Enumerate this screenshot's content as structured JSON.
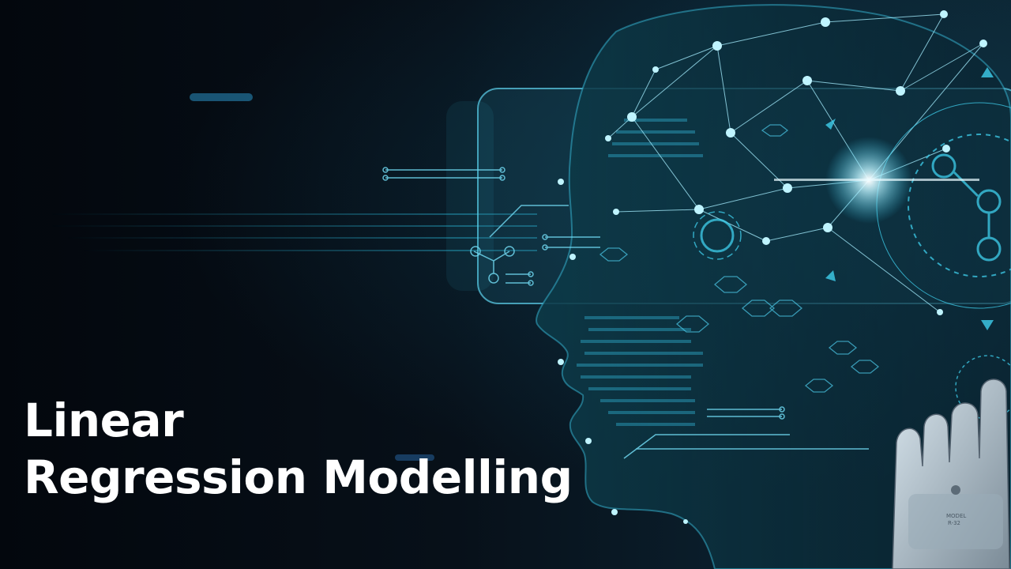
{
  "title": {
    "line1": "Linear",
    "line2": "Regression Modelling"
  },
  "illustration": {
    "subject": "ai-head-neural-network-icon",
    "accent_color": "#2fc7ea",
    "glow_color": "#bff4ff",
    "background_color": "#050a12",
    "robot_hand_label": "MODEL R-32"
  }
}
